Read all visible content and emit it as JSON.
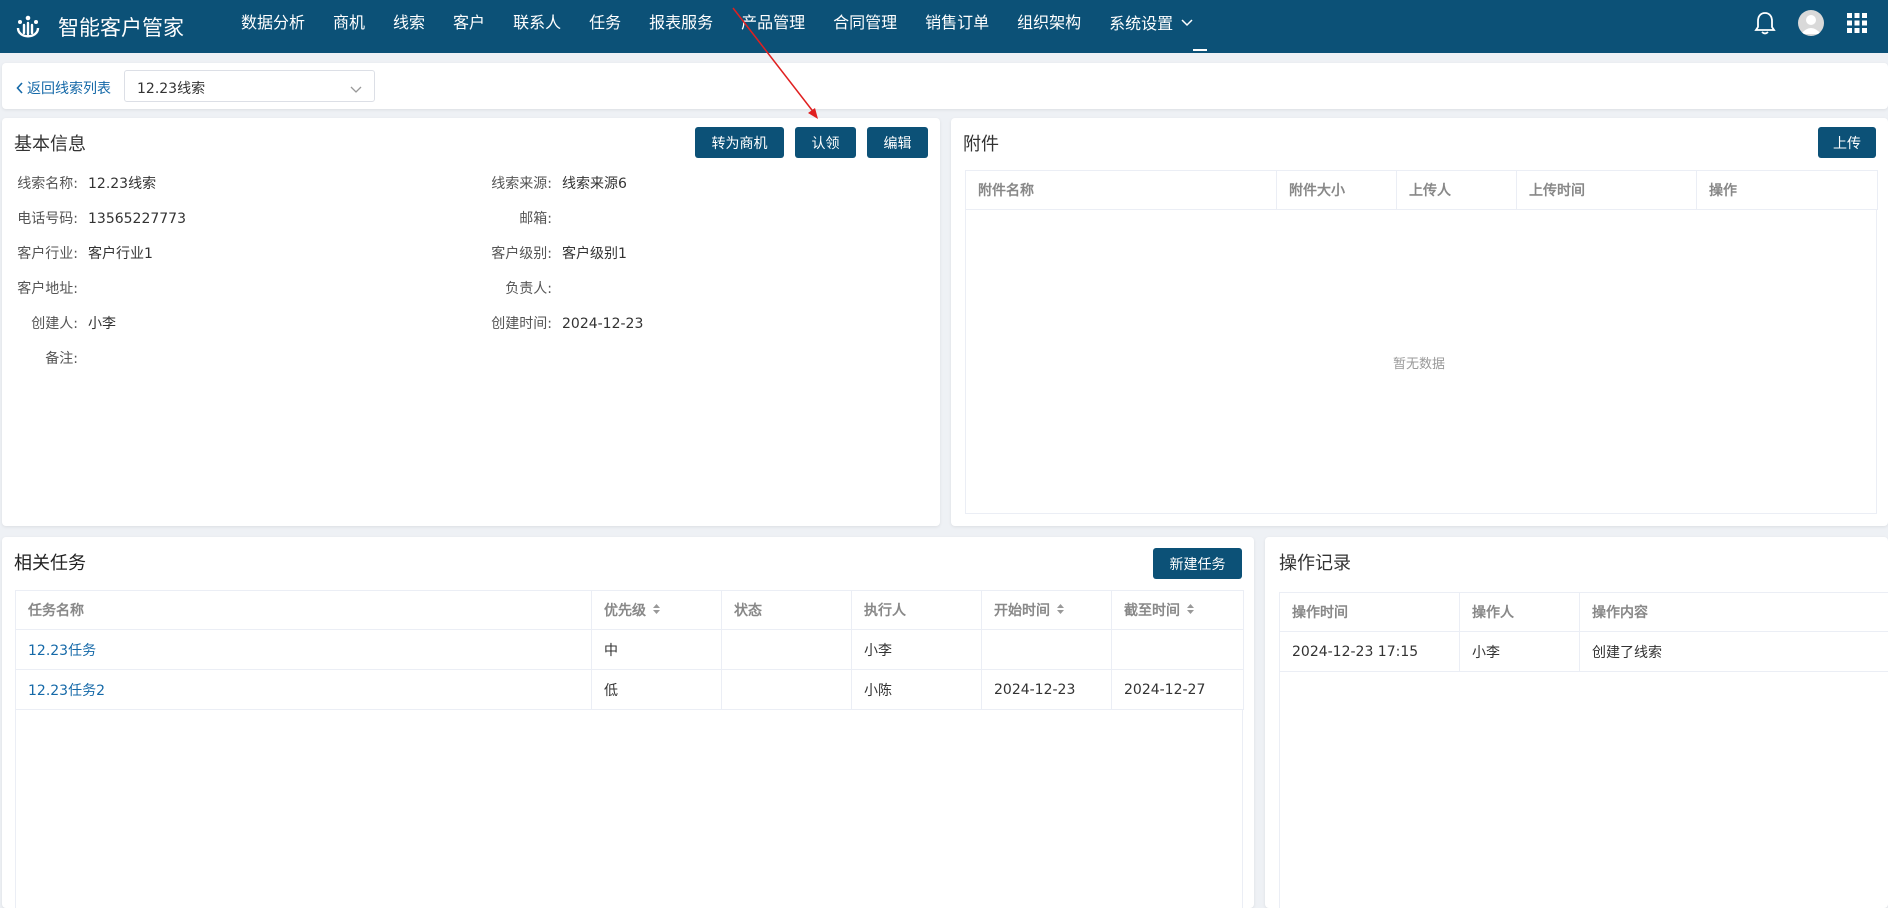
{
  "app": {
    "title": "智能客户管家"
  },
  "nav": {
    "items": [
      "数据分析",
      "商机",
      "线索",
      "客户",
      "联系人",
      "任务",
      "报表服务",
      "产品管理",
      "合同管理",
      "销售订单",
      "组织架构",
      "系统设置"
    ]
  },
  "breadcrumb": {
    "back_label": "返回线索列表",
    "selected": "12.23线索"
  },
  "basic": {
    "title": "基本信息",
    "buttons": {
      "convert": "转为商机",
      "claim": "认领",
      "edit": "编辑"
    },
    "fields": {
      "lead_name_label": "线索名称:",
      "lead_name": "12.23线索",
      "source_label": "线索来源:",
      "source": "线索来源6",
      "phone_label": "电话号码:",
      "phone": "13565227773",
      "email_label": "邮箱:",
      "email": "",
      "industry_label": "客户行业:",
      "industry": "客户行业1",
      "level_label": "客户级别:",
      "level": "客户级别1",
      "address_label": "客户地址:",
      "address": "",
      "owner_label": "负责人:",
      "owner": "",
      "creator_label": "创建人:",
      "creator": "小李",
      "created_label": "创建时间:",
      "created": "2024-12-23",
      "remark_label": "备注:",
      "remark": ""
    }
  },
  "attachments": {
    "title": "附件",
    "upload": "上传",
    "columns": [
      "附件名称",
      "附件大小",
      "上传人",
      "上传时间",
      "操作"
    ],
    "empty": "暂无数据"
  },
  "tasks": {
    "title": "相关任务",
    "new_button": "新建任务",
    "columns": [
      "任务名称",
      "优先级",
      "状态",
      "执行人",
      "开始时间",
      "截至时间"
    ],
    "rows": [
      [
        "12.23任务",
        "中",
        "",
        "小李",
        "",
        ""
      ],
      [
        "12.23任务2",
        "低",
        "",
        "小陈",
        "2024-12-23",
        "2024-12-27"
      ]
    ]
  },
  "logs": {
    "title": "操作记录",
    "columns": [
      "操作时间",
      "操作人",
      "操作内容"
    ],
    "rows": [
      [
        "2024-12-23 17:15",
        "小李",
        "创建了线索"
      ]
    ]
  }
}
